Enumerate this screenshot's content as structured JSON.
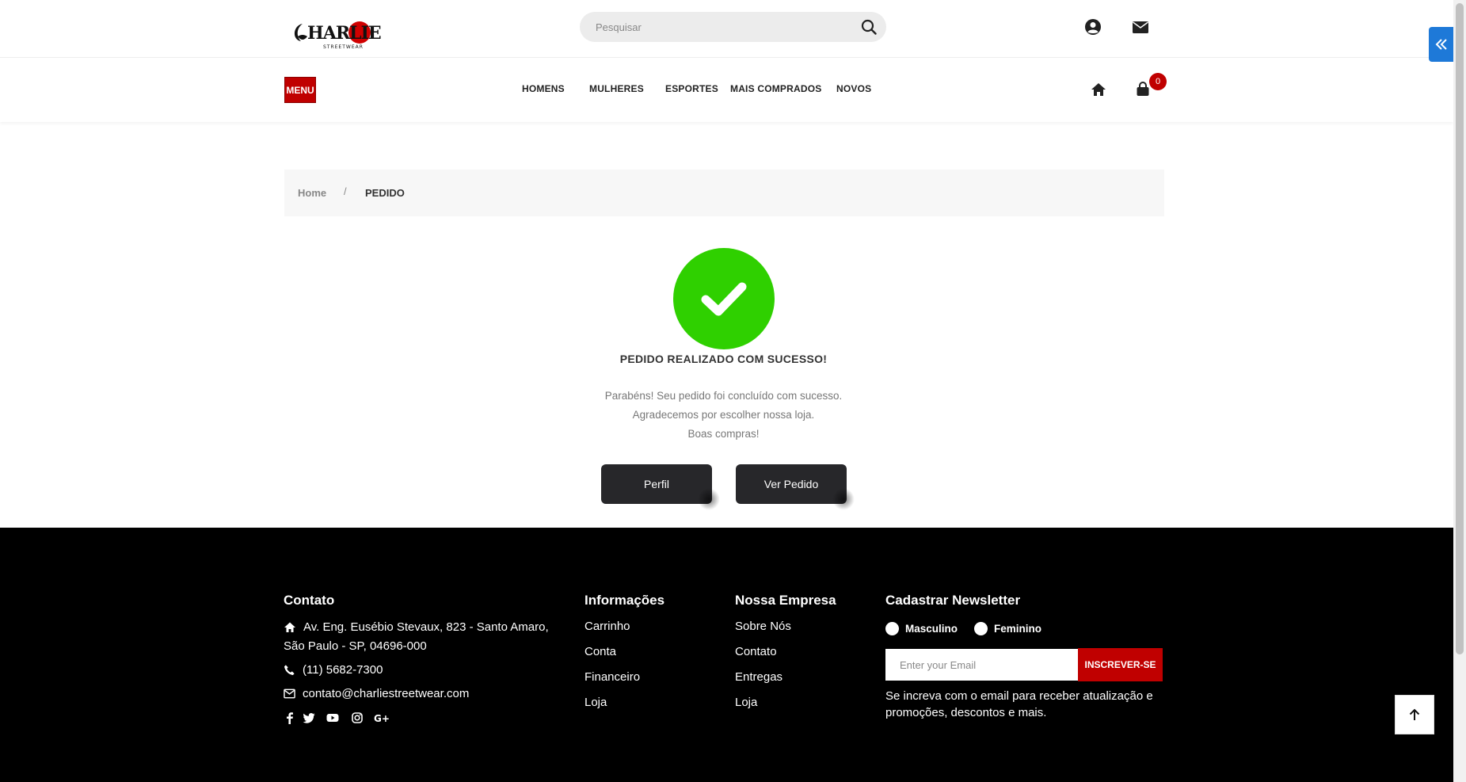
{
  "header": {
    "logo_text": "CHARLIE",
    "logo_subtext": "STREETWEAR",
    "search_placeholder": "Pesquisar",
    "icons": [
      "user-circle-icon",
      "envelope-icon"
    ]
  },
  "nav": {
    "menu_label": "MENU",
    "links": [
      "HOMENS",
      "MULHERES",
      "ESPORTES",
      "MAIS COMPRADOS",
      "NOVOS"
    ],
    "cart_count": "0"
  },
  "breadcrumb": {
    "home": "Home",
    "separator": "/",
    "current": "PEDIDO"
  },
  "success": {
    "title": "PEDIDO REALIZADO COM SUCESSO!",
    "lines": [
      "Parabéns! Seu pedido foi concluído com sucesso.",
      "Agradecemos por escolher nossa loja.",
      "Boas compras!"
    ],
    "profile_button": "Perfil",
    "order_button": "Ver Pedido",
    "color": "#2fd000"
  },
  "footer": {
    "contact": {
      "heading": "Contato",
      "address": "Av. Eng. Eusébio Stevaux, 823 - Santo Amaro, São Paulo - SP, 04696-000",
      "phone": "(11) 5682-7300",
      "email": "contato@charliestreetwear.com"
    },
    "info": {
      "heading": "Informações",
      "links": [
        "Carrinho",
        "Conta",
        "Financeiro",
        "Loja"
      ]
    },
    "company": {
      "heading": "Nossa Empresa",
      "links": [
        "Sobre Nós",
        "Contato",
        "Entregas",
        "Loja"
      ]
    },
    "newsletter": {
      "heading": "Cadastrar Newsletter",
      "option_male": "Masculino",
      "option_female": "Feminino",
      "email_placeholder": "Enter your Email",
      "button": "INSCREVER-SE",
      "description": "Se increva com o email para receber atualização e promoções, descontos e mais."
    }
  },
  "colors": {
    "brand_red": "#c00000",
    "button_dark": "#27272a",
    "sidetab_blue": "#1e79d8"
  }
}
